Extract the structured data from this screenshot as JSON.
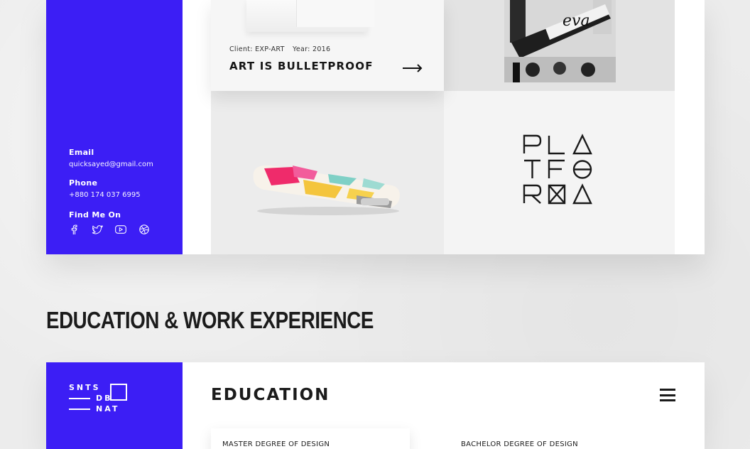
{
  "colors": {
    "accent": "#3c1ef5",
    "text": "#1b1b1b",
    "background": "#eeeeee"
  },
  "contact": {
    "email_label": "Email",
    "email_value": "quicksayed@gmail.com",
    "phone_label": "Phone",
    "phone_value": "+880 174 037 6995",
    "find_label": "Find Me On",
    "socials": [
      "facebook-icon",
      "twitter-icon",
      "youtube-icon",
      "dribbble-icon"
    ]
  },
  "portfolio": {
    "featured": {
      "client": "Client: EXP-ART",
      "year": "Year: 2016",
      "title": "ART IS BULLETPROOF"
    },
    "poster_text": "eva"
  },
  "section_title": "EDUCATION & WORK EXPERIENCE",
  "brand": {
    "row1": "SNTS",
    "row2": "DB",
    "row3": "NAT"
  },
  "education": {
    "heading": "EDUCATION",
    "items": [
      "MASTER DEGREE OF DESIGN",
      "BACHELOR DEGREE OF DESIGN"
    ]
  }
}
